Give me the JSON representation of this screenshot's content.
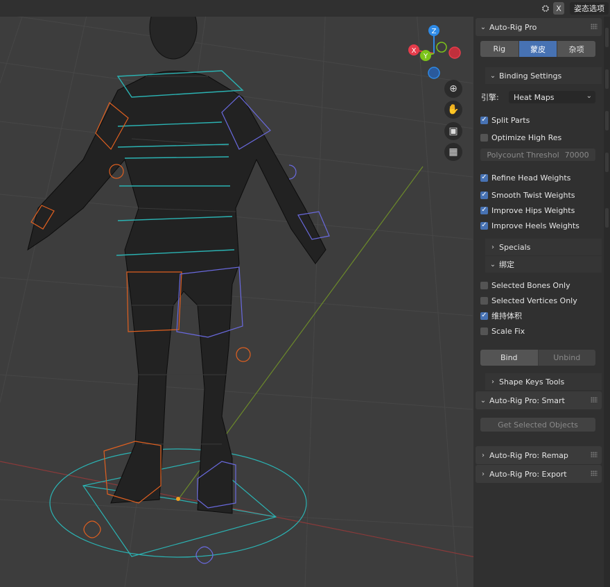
{
  "header": {
    "mode_label": "姿态选项",
    "close_label": "X",
    "icon": "overlay-icon"
  },
  "gizmo": {
    "z_label": "Z",
    "x_label": "X",
    "y_label": "Y",
    "colors": {
      "z": "#2e8ae6",
      "x": "#e63c4b",
      "y": "#7dc31a"
    }
  },
  "nav_tools": [
    {
      "name": "zoom-icon",
      "glyph": "⊕"
    },
    {
      "name": "hand-pan-icon",
      "glyph": "✋"
    },
    {
      "name": "camera-icon",
      "glyph": "🎥"
    },
    {
      "name": "grid-view-icon",
      "glyph": "▦"
    }
  ],
  "panel": {
    "title": "Auto-Rig Pro",
    "tabs": [
      {
        "label": "Rig",
        "active": false
      },
      {
        "label": "蒙皮",
        "active": true
      },
      {
        "label": "杂项",
        "active": false
      }
    ],
    "binding_settings": {
      "header": "Binding Settings",
      "engine_label": "引擎:",
      "engine_value": "Heat Maps",
      "split_parts": {
        "label": "Split Parts",
        "checked": true
      },
      "optimize_high_res": {
        "label": "Optimize High Res",
        "checked": false
      },
      "polycount_label": "Polycount Threshol",
      "polycount_value": "70000",
      "refine_head": {
        "label": "Refine Head Weights",
        "checked": true
      },
      "smooth_twist": {
        "label": "Smooth Twist Weights",
        "checked": true
      },
      "improve_hips": {
        "label": "Improve Hips Weights",
        "checked": true
      },
      "improve_heels": {
        "label": "Improve Heels Weights",
        "checked": true
      }
    },
    "specials": {
      "header": "Specials"
    },
    "bind_section": {
      "header": "绑定",
      "selected_bones_only": {
        "label": "Selected Bones Only",
        "checked": false
      },
      "selected_vertices_only": {
        "label": "Selected Vertices Only",
        "checked": false
      },
      "preserve_volume": {
        "label": "维持体积",
        "checked": true
      },
      "scale_fix": {
        "label": "Scale Fix",
        "checked": false
      },
      "bind_label": "Bind",
      "unbind_label": "Unbind"
    },
    "shape_keys": {
      "header": "Shape Keys Tools"
    },
    "smart": {
      "title": "Auto-Rig Pro: Smart",
      "get_selected_label": "Get Selected Objects"
    },
    "remap": {
      "title": "Auto-Rig Pro: Remap"
    },
    "export": {
      "title": "Auto-Rig Pro: Export"
    }
  }
}
